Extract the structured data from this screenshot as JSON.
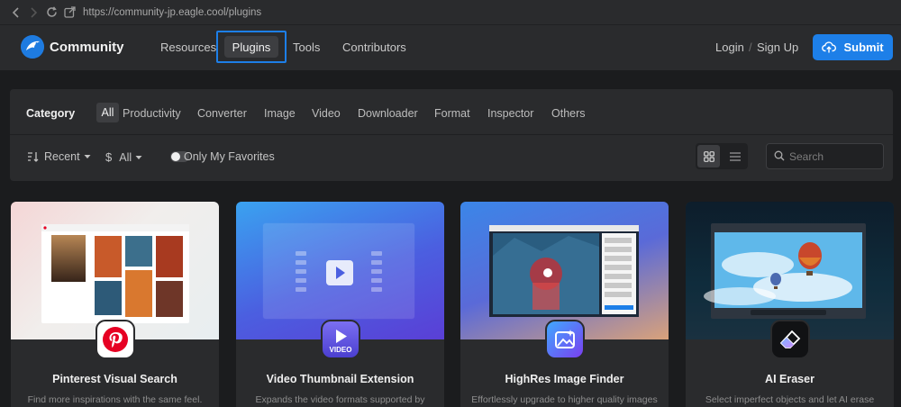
{
  "browser": {
    "url": "https://community-jp.eagle.cool/plugins"
  },
  "nav": {
    "brand": "Community",
    "links": [
      "Resources",
      "Plugins",
      "Tools",
      "Contributors"
    ],
    "login": "Login",
    "separator": "/",
    "signup": "Sign Up",
    "submit": "Submit"
  },
  "filters": {
    "category_label": "Category",
    "categories": [
      "All",
      "Productivity",
      "Converter",
      "Image",
      "Video",
      "Downloader",
      "Format",
      "Inspector",
      "Others"
    ],
    "selected_category": "All",
    "sort": "Recent",
    "price_symbol": "$",
    "price": "All",
    "favorites_label": "Only My Favorites",
    "favorites_on": false,
    "view_mode": "grid",
    "search_placeholder": "Search"
  },
  "cards": [
    {
      "title": "Pinterest Visual Search",
      "desc": "Find more inspirations with the same feel.",
      "icon": "pinterest-icon"
    },
    {
      "title": "Video Thumbnail Extension",
      "desc": "Expands the video formats supported by",
      "icon": "video-icon",
      "icon_label": "VIDEO"
    },
    {
      "title": "HighRes Image Finder",
      "desc": "Effortlessly upgrade to higher quality images",
      "icon": "image-sparkle-icon"
    },
    {
      "title": "AI Eraser",
      "desc": "Select imperfect objects and let AI erase",
      "icon": "eraser-icon"
    }
  ],
  "colors": {
    "accent": "#1d7fe8",
    "background": "#1b1c1e",
    "panel": "#2a2b2d",
    "pinterest": "#e60023"
  }
}
